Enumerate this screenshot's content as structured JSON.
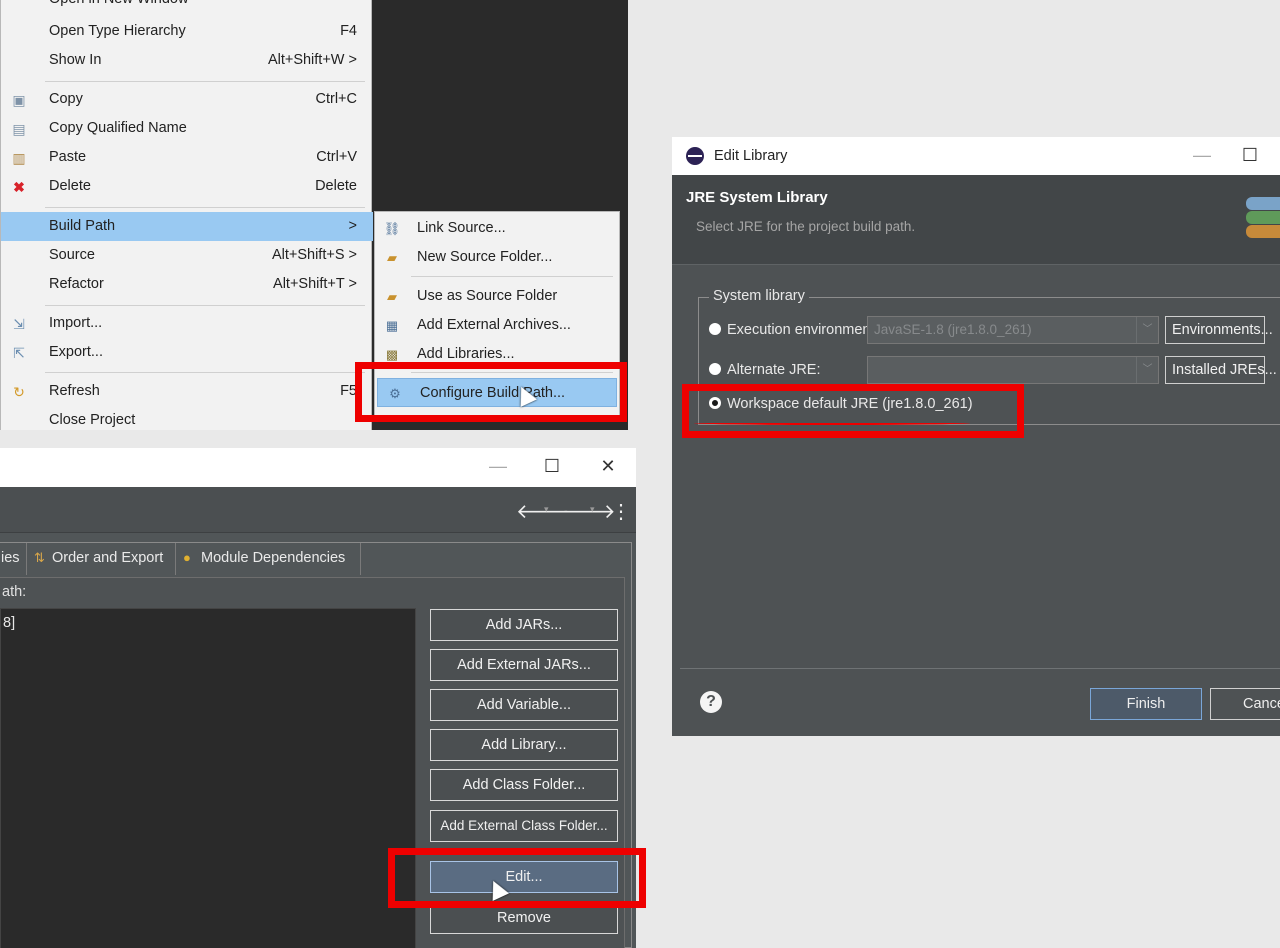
{
  "context_menu": {
    "items": [
      {
        "label": "Open in New Window",
        "shortcut": ""
      },
      {
        "label": "Open Type Hierarchy",
        "shortcut": "F4"
      },
      {
        "label": "Show In",
        "shortcut": "Alt+Shift+W >"
      },
      {
        "label": "Copy",
        "shortcut": "Ctrl+C"
      },
      {
        "label": "Copy Qualified Name",
        "shortcut": ""
      },
      {
        "label": "Paste",
        "shortcut": "Ctrl+V"
      },
      {
        "label": "Delete",
        "shortcut": "Delete"
      },
      {
        "label": "Build Path",
        "shortcut": ">"
      },
      {
        "label": "Source",
        "shortcut": "Alt+Shift+S >"
      },
      {
        "label": "Refactor",
        "shortcut": "Alt+Shift+T >"
      },
      {
        "label": "Import...",
        "shortcut": ""
      },
      {
        "label": "Export...",
        "shortcut": ""
      },
      {
        "label": "Refresh",
        "shortcut": "F5"
      },
      {
        "label": "Close Project",
        "shortcut": ""
      }
    ],
    "submenu": [
      {
        "label": "Link Source..."
      },
      {
        "label": "New Source Folder..."
      },
      {
        "label": "Use as Source Folder"
      },
      {
        "label": "Add External Archives..."
      },
      {
        "label": "Add Libraries..."
      },
      {
        "label": "Configure Build Path..."
      }
    ]
  },
  "build_path_dialog": {
    "window_controls": {
      "minimize": "—",
      "maximize": "☐",
      "close": "✕"
    },
    "tabs": [
      {
        "label": "ies"
      },
      {
        "label": "Order and Export"
      },
      {
        "label": "Module Dependencies"
      }
    ],
    "list_label": "ath:",
    "list_rows": [
      "8]"
    ],
    "buttons": [
      "Add JARs...",
      "Add External JARs...",
      "Add Variable...",
      "Add Library...",
      "Add Class Folder...",
      "Add External Class Folder...",
      "Edit...",
      "Remove"
    ]
  },
  "edit_library_dialog": {
    "title": "Edit Library",
    "heading": "JRE System Library",
    "description": "Select JRE for the project build path.",
    "group_label": "System library",
    "options": [
      {
        "label": "Execution environment:",
        "combo": "JavaSE-1.8 (jre1.8.0_261)",
        "button": "Environments...",
        "selected": false
      },
      {
        "label": "Alternate JRE:",
        "combo": "",
        "button": "Installed JREs...",
        "selected": false
      },
      {
        "label": "Workspace default JRE (jre1.8.0_261)",
        "selected": true
      }
    ],
    "finish_label": "Finish",
    "cancel_label": "Cancel",
    "help_glyph": "?"
  },
  "colors": {
    "highlight": "#99c9f2",
    "annotation_red": "#ee0000",
    "dialog_bg": "#4e5254"
  }
}
